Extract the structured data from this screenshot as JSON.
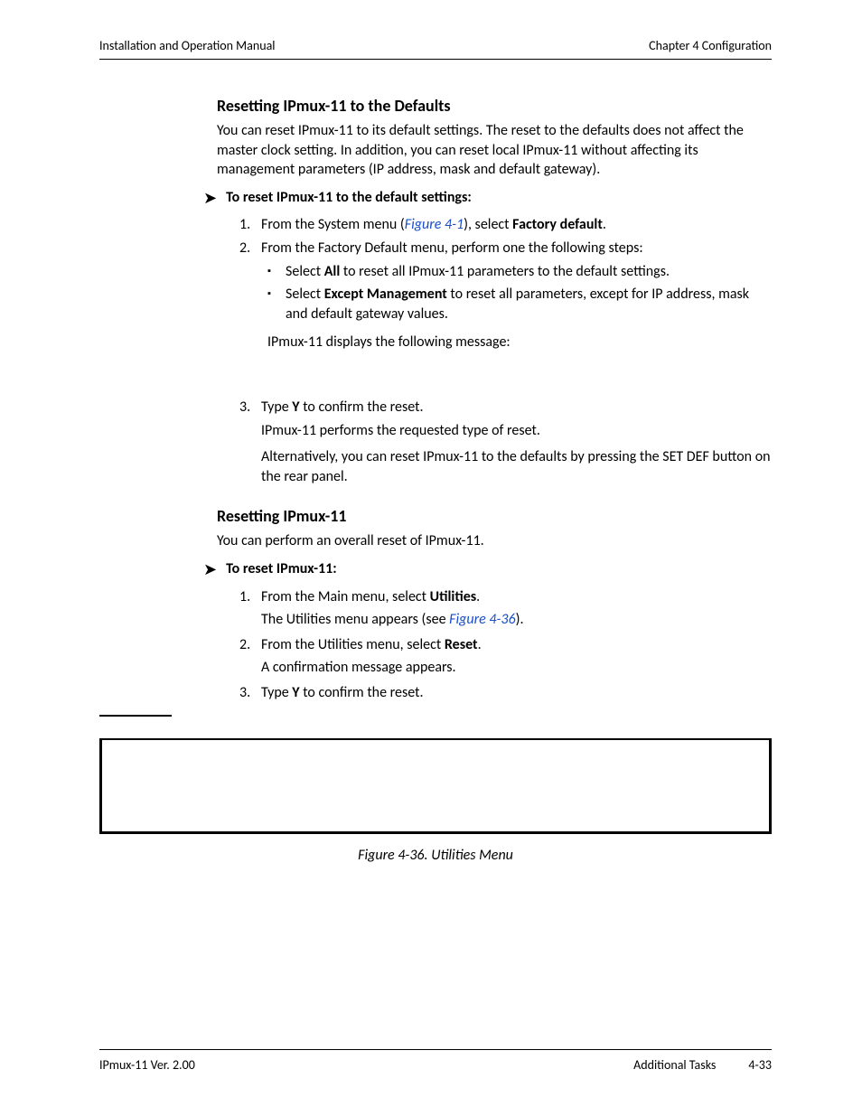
{
  "header": {
    "left": "Installation and Operation Manual",
    "right": "Chapter 4  Configuration"
  },
  "section1": {
    "heading": "Resetting IPmux-11 to the Defaults",
    "intro": "You can reset IPmux-11 to its default settings. The reset to the defaults does not affect the master clock setting. In addition, you can reset local IPmux-11 without affecting its management parameters (IP address, mask and default gateway).",
    "proc_title": "To reset IPmux-11 to the default settings:",
    "step1_pre": "From the System menu (",
    "step1_link": "Figure 4-1",
    "step1_mid": "), select ",
    "step1_bold": "Factory default",
    "step1_post": ".",
    "step2": "From the Factory Default menu, perform one the following steps:",
    "bullet1_pre": "Select ",
    "bullet1_bold": "All",
    "bullet1_post": " to reset all IPmux-11 parameters to the default settings.",
    "bullet2_pre": "Select ",
    "bullet2_bold": "Except Management",
    "bullet2_post": " to reset all parameters, except for IP address, mask and default gateway values.",
    "msg": "IPmux-11 displays the following message:",
    "step3_pre": "Type ",
    "step3_bold": "Y",
    "step3_post": " to confirm the reset.",
    "step3_result": "IPmux-11 performs the requested type of reset.",
    "alt": "Alternatively, you can reset IPmux-11 to the defaults by pressing the SET DEF button on the rear panel."
  },
  "section2": {
    "heading": "Resetting IPmux-11",
    "intro": "You can perform an overall reset of IPmux-11.",
    "proc_title": "To reset IPmux-11:",
    "step1_pre": "From the Main menu, select ",
    "step1_bold": "Utilities",
    "step1_post": ".",
    "step1_res_pre": "The Utilities menu appears (see ",
    "step1_res_link": "Figure 4-36",
    "step1_res_post": ").",
    "step2_pre": "From the Utilities menu, select ",
    "step2_bold": "Reset",
    "step2_post": ".",
    "step2_res": "A confirmation message appears.",
    "step3_pre": "Type ",
    "step3_bold": "Y",
    "step3_post": " to confirm the reset."
  },
  "figure": {
    "caption": "Figure 4-36.  Utilities Menu"
  },
  "footer": {
    "left": "IPmux-11 Ver. 2.00",
    "right_label": "Additional Tasks",
    "page": "4-33"
  },
  "nums": {
    "n1": "1.",
    "n2": "2.",
    "n3": "3."
  },
  "glyph": {
    "arrow": "➤",
    "square": "▪"
  }
}
